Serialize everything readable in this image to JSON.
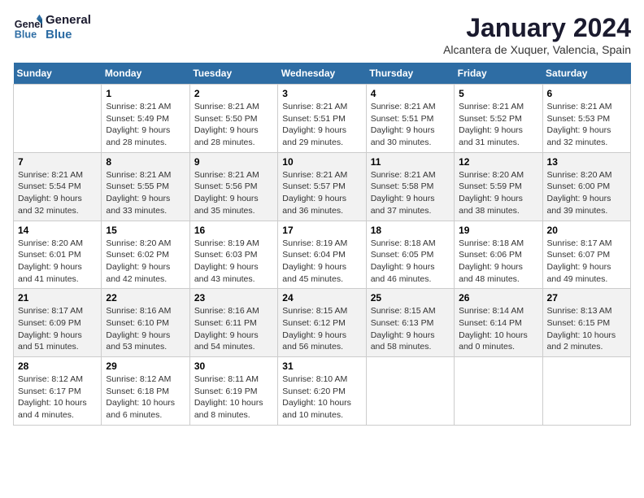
{
  "logo": {
    "line1": "General",
    "line2": "Blue"
  },
  "title": "January 2024",
  "subtitle": "Alcantera de Xuquer, Valencia, Spain",
  "days_header": [
    "Sunday",
    "Monday",
    "Tuesday",
    "Wednesday",
    "Thursday",
    "Friday",
    "Saturday"
  ],
  "weeks": [
    [
      {
        "num": "",
        "info": ""
      },
      {
        "num": "1",
        "info": "Sunrise: 8:21 AM\nSunset: 5:49 PM\nDaylight: 9 hours\nand 28 minutes."
      },
      {
        "num": "2",
        "info": "Sunrise: 8:21 AM\nSunset: 5:50 PM\nDaylight: 9 hours\nand 28 minutes."
      },
      {
        "num": "3",
        "info": "Sunrise: 8:21 AM\nSunset: 5:51 PM\nDaylight: 9 hours\nand 29 minutes."
      },
      {
        "num": "4",
        "info": "Sunrise: 8:21 AM\nSunset: 5:51 PM\nDaylight: 9 hours\nand 30 minutes."
      },
      {
        "num": "5",
        "info": "Sunrise: 8:21 AM\nSunset: 5:52 PM\nDaylight: 9 hours\nand 31 minutes."
      },
      {
        "num": "6",
        "info": "Sunrise: 8:21 AM\nSunset: 5:53 PM\nDaylight: 9 hours\nand 32 minutes."
      }
    ],
    [
      {
        "num": "7",
        "info": "Sunrise: 8:21 AM\nSunset: 5:54 PM\nDaylight: 9 hours\nand 32 minutes."
      },
      {
        "num": "8",
        "info": "Sunrise: 8:21 AM\nSunset: 5:55 PM\nDaylight: 9 hours\nand 33 minutes."
      },
      {
        "num": "9",
        "info": "Sunrise: 8:21 AM\nSunset: 5:56 PM\nDaylight: 9 hours\nand 35 minutes."
      },
      {
        "num": "10",
        "info": "Sunrise: 8:21 AM\nSunset: 5:57 PM\nDaylight: 9 hours\nand 36 minutes."
      },
      {
        "num": "11",
        "info": "Sunrise: 8:21 AM\nSunset: 5:58 PM\nDaylight: 9 hours\nand 37 minutes."
      },
      {
        "num": "12",
        "info": "Sunrise: 8:20 AM\nSunset: 5:59 PM\nDaylight: 9 hours\nand 38 minutes."
      },
      {
        "num": "13",
        "info": "Sunrise: 8:20 AM\nSunset: 6:00 PM\nDaylight: 9 hours\nand 39 minutes."
      }
    ],
    [
      {
        "num": "14",
        "info": "Sunrise: 8:20 AM\nSunset: 6:01 PM\nDaylight: 9 hours\nand 41 minutes."
      },
      {
        "num": "15",
        "info": "Sunrise: 8:20 AM\nSunset: 6:02 PM\nDaylight: 9 hours\nand 42 minutes."
      },
      {
        "num": "16",
        "info": "Sunrise: 8:19 AM\nSunset: 6:03 PM\nDaylight: 9 hours\nand 43 minutes."
      },
      {
        "num": "17",
        "info": "Sunrise: 8:19 AM\nSunset: 6:04 PM\nDaylight: 9 hours\nand 45 minutes."
      },
      {
        "num": "18",
        "info": "Sunrise: 8:18 AM\nSunset: 6:05 PM\nDaylight: 9 hours\nand 46 minutes."
      },
      {
        "num": "19",
        "info": "Sunrise: 8:18 AM\nSunset: 6:06 PM\nDaylight: 9 hours\nand 48 minutes."
      },
      {
        "num": "20",
        "info": "Sunrise: 8:17 AM\nSunset: 6:07 PM\nDaylight: 9 hours\nand 49 minutes."
      }
    ],
    [
      {
        "num": "21",
        "info": "Sunrise: 8:17 AM\nSunset: 6:09 PM\nDaylight: 9 hours\nand 51 minutes."
      },
      {
        "num": "22",
        "info": "Sunrise: 8:16 AM\nSunset: 6:10 PM\nDaylight: 9 hours\nand 53 minutes."
      },
      {
        "num": "23",
        "info": "Sunrise: 8:16 AM\nSunset: 6:11 PM\nDaylight: 9 hours\nand 54 minutes."
      },
      {
        "num": "24",
        "info": "Sunrise: 8:15 AM\nSunset: 6:12 PM\nDaylight: 9 hours\nand 56 minutes."
      },
      {
        "num": "25",
        "info": "Sunrise: 8:15 AM\nSunset: 6:13 PM\nDaylight: 9 hours\nand 58 minutes."
      },
      {
        "num": "26",
        "info": "Sunrise: 8:14 AM\nSunset: 6:14 PM\nDaylight: 10 hours\nand 0 minutes."
      },
      {
        "num": "27",
        "info": "Sunrise: 8:13 AM\nSunset: 6:15 PM\nDaylight: 10 hours\nand 2 minutes."
      }
    ],
    [
      {
        "num": "28",
        "info": "Sunrise: 8:12 AM\nSunset: 6:17 PM\nDaylight: 10 hours\nand 4 minutes."
      },
      {
        "num": "29",
        "info": "Sunrise: 8:12 AM\nSunset: 6:18 PM\nDaylight: 10 hours\nand 6 minutes."
      },
      {
        "num": "30",
        "info": "Sunrise: 8:11 AM\nSunset: 6:19 PM\nDaylight: 10 hours\nand 8 minutes."
      },
      {
        "num": "31",
        "info": "Sunrise: 8:10 AM\nSunset: 6:20 PM\nDaylight: 10 hours\nand 10 minutes."
      },
      {
        "num": "",
        "info": ""
      },
      {
        "num": "",
        "info": ""
      },
      {
        "num": "",
        "info": ""
      }
    ]
  ]
}
